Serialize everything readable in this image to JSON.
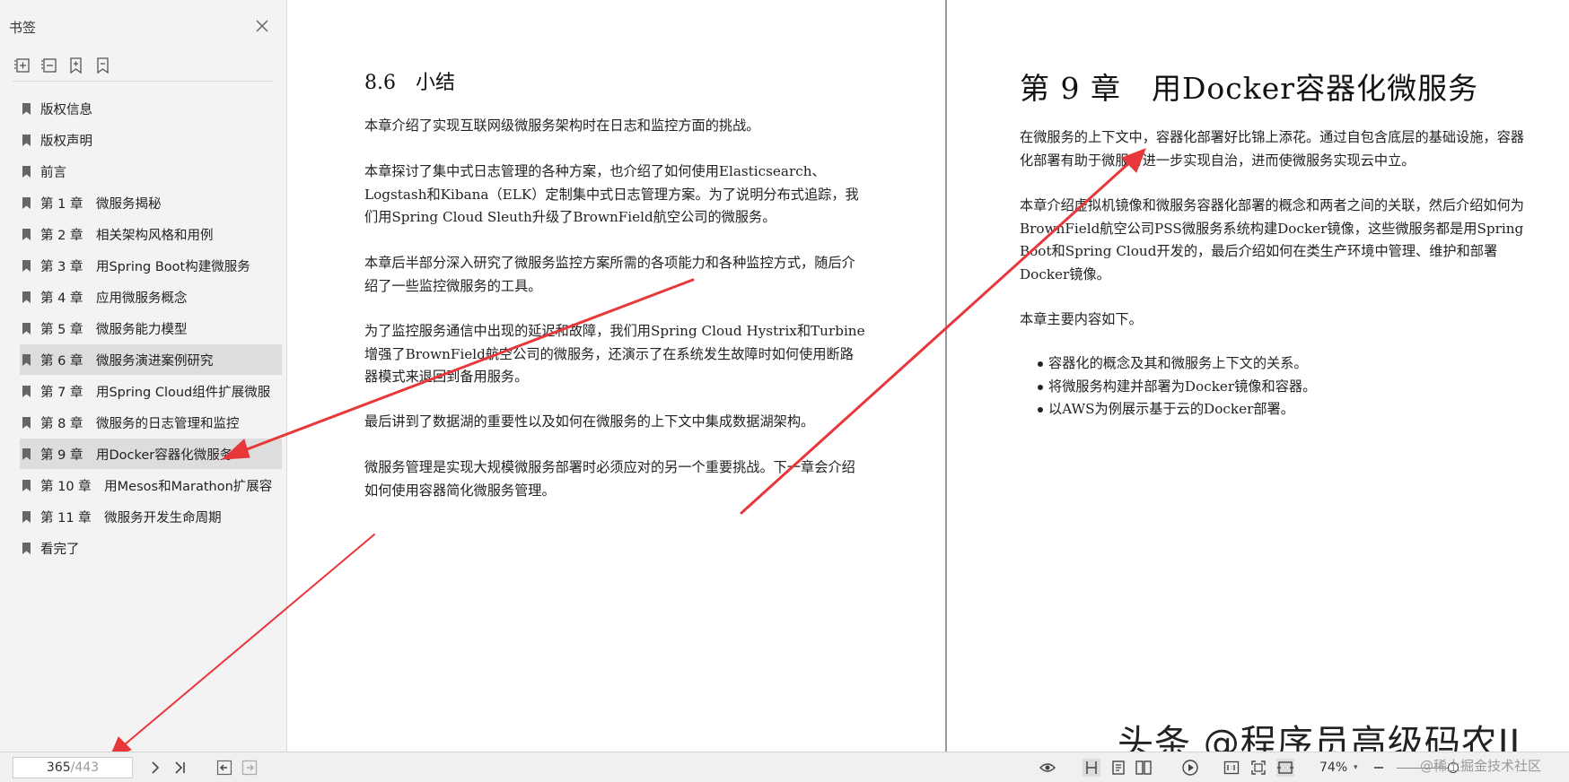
{
  "sidebar": {
    "title": "书签",
    "bookmarks": [
      {
        "label": "版权信息",
        "expandable": false
      },
      {
        "label": "版权声明",
        "expandable": false
      },
      {
        "label": "前言",
        "expandable": true
      },
      {
        "label": "第 1 章　微服务揭秘",
        "expandable": true
      },
      {
        "label": "第 2 章　相关架构风格和用例",
        "expandable": true
      },
      {
        "label": "第 3 章　用Spring Boot构建微服务",
        "expandable": true
      },
      {
        "label": "第 4 章　应用微服务概念",
        "expandable": true
      },
      {
        "label": "第 5 章　微服务能力模型",
        "expandable": true
      },
      {
        "label": "第 6 章　微服务演进案例研究",
        "expandable": true,
        "highlighted": true
      },
      {
        "label": "第 7 章　用Spring Cloud组件扩展微服",
        "expandable": true
      },
      {
        "label": "第 8 章　微服务的日志管理和监控",
        "expandable": true
      },
      {
        "label": "第 9 章　用Docker容器化微服务",
        "expandable": true,
        "selected": true
      },
      {
        "label": "第 10 章　用Mesos和Marathon扩展容",
        "expandable": true
      },
      {
        "label": "第 11 章　微服务开发生命周期",
        "expandable": true
      },
      {
        "label": "看完了",
        "expandable": false
      }
    ]
  },
  "left_page": {
    "section_title": "8.6　小结",
    "paragraphs": [
      "本章介绍了实现互联网级微服务架构时在日志和监控方面的挑战。",
      "本章探讨了集中式日志管理的各种方案，也介绍了如何使用Elasticsearch、Logstash和Kibana（ELK）定制集中式日志管理方案。为了说明分布式追踪，我们用Spring Cloud Sleuth升级了BrownField航空公司的微服务。",
      "本章后半部分深入研究了微服务监控方案所需的各项能力和各种监控方式，随后介绍了一些监控微服务的工具。",
      "为了监控服务通信中出现的延迟和故障，我们用Spring Cloud Hystrix和Turbine增强了BrownField航空公司的微服务，还演示了在系统发生故障时如何使用断路器模式来退回到备用服务。",
      "最后讲到了数据湖的重要性以及如何在微服务的上下文中集成数据湖架构。",
      "微服务管理是实现大规模微服务部署时必须应对的另一个重要挑战。下一章会介绍如何使用容器简化微服务管理。"
    ]
  },
  "right_page": {
    "chapter_title": "第 9 章　用Docker容器化微服务",
    "paragraphs": [
      "在微服务的上下文中，容器化部署好比锦上添花。通过自包含底层的基础设施，容器化部署有助于微服务进一步实现自治，进而使微服务实现云中立。",
      "本章介绍虚拟机镜像和微服务容器化部署的概念和两者之间的关联，然后介绍如何为BrownField航空公司PSS微服务系统构建Docker镜像，这些微服务都是用Spring Boot和Spring Cloud开发的，最后介绍如何在类生产环境中管理、维护和部署Docker镜像。",
      "本章主要内容如下。"
    ],
    "bullets": [
      "容器化的概念及其和微服务上下文的关系。",
      "将微服务构建并部署为Docker镜像和容器。",
      "以AWS为例展示基于云的Docker部署。"
    ]
  },
  "statusbar": {
    "current_page": "365",
    "total_pages": "/443",
    "zoom": "74%",
    "icons": [
      "next-page-icon",
      "last-page-icon",
      "back-icon",
      "forward-icon",
      "eye-icon",
      "single-page-icon",
      "continuous-icon",
      "two-page-icon",
      "play-icon",
      "actual-size-icon",
      "fit-page-icon",
      "fit-width-icon",
      "zoom-out-icon"
    ]
  },
  "watermark": {
    "main": "头条 @程序员高级码农II",
    "sub": "@稀土掘金技术社区"
  },
  "colors": {
    "arrow": "#e8373a",
    "sidebar_bg": "#f3f3f3",
    "selected_bg": "#dddddd"
  }
}
